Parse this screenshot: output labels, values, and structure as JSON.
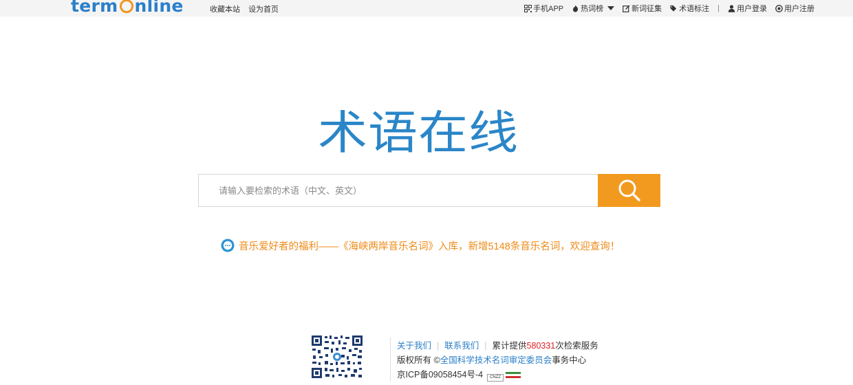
{
  "header": {
    "logo_part1": "term",
    "logo_part2": "nline",
    "left_links": [
      "收藏本站",
      "设为首页"
    ],
    "mobile_app": "手机APP",
    "hot_words": "热词榜",
    "new_words": "新词征集",
    "term_tag": "术语标注",
    "separator": "|",
    "login": "用户登录",
    "register": "用户注册"
  },
  "brand": {
    "title": "术语在线"
  },
  "search": {
    "placeholder": "请输入要检索的术语（中文、英文）",
    "value": ""
  },
  "notice": {
    "text": "音乐爱好者的福利——《海峡两岸音乐名词》入库，新增5148条音乐名词，欢迎查询！"
  },
  "footer": {
    "about": "关于我们",
    "contact": "联系我们",
    "stats_prefix": "累计提供",
    "stats_count": "580331",
    "stats_suffix": "次检索服务",
    "copyright_prefix": "版权所有 ©",
    "committee": "全国科学技术名词审定委员会",
    "copyright_suffix": "事务中心",
    "icp": "京ICP备09058454号-4",
    "cnzz": "CNZZ"
  },
  "colors": {
    "brand_blue": "#2a86c8",
    "accent_orange": "#f29a1f",
    "notice_orange": "#ee8a17",
    "stat_red": "#e0201f"
  }
}
